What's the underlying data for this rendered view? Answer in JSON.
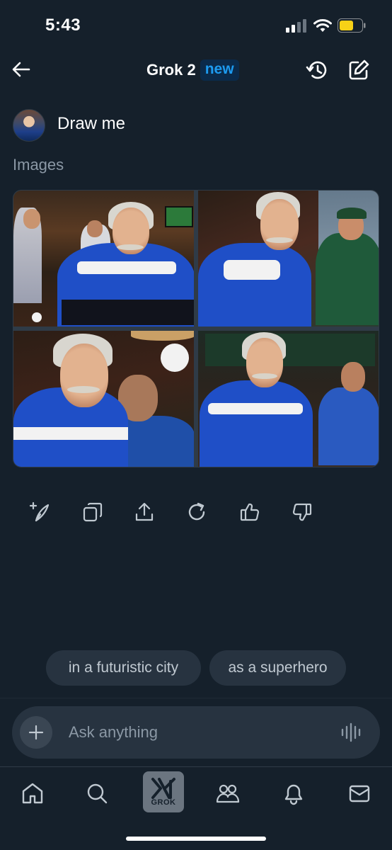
{
  "status_bar": {
    "time": "5:43",
    "icons": [
      "signal-icon",
      "wifi-icon",
      "battery-icon"
    ],
    "battery_color": "#f7d117"
  },
  "header": {
    "title": "Grok 2",
    "badge": "new",
    "icons": [
      "back-arrow-icon",
      "history-icon",
      "compose-icon"
    ]
  },
  "prompt": {
    "text": "Draw me"
  },
  "images": {
    "label": "Images",
    "count": 4
  },
  "actions": {
    "icons": [
      "regenerate-sparkle-icon",
      "copy-icon",
      "share-icon",
      "refresh-icon",
      "thumbs-up-icon",
      "thumbs-down-icon"
    ]
  },
  "suggestions": [
    {
      "label": "in a futuristic city"
    },
    {
      "label": "as a superhero"
    }
  ],
  "composer": {
    "placeholder": "Ask anything",
    "icons": [
      "plus-icon",
      "voice-icon"
    ]
  },
  "bottom_nav": {
    "items": [
      "home-icon",
      "search-icon",
      "grok-icon",
      "communities-icon",
      "notifications-icon",
      "messages-icon"
    ],
    "grok_label": "GROK"
  },
  "colors": {
    "background": "#15202b",
    "accent": "#1d9bf0",
    "chip": "#273340",
    "muted_text": "#8b98a5"
  }
}
